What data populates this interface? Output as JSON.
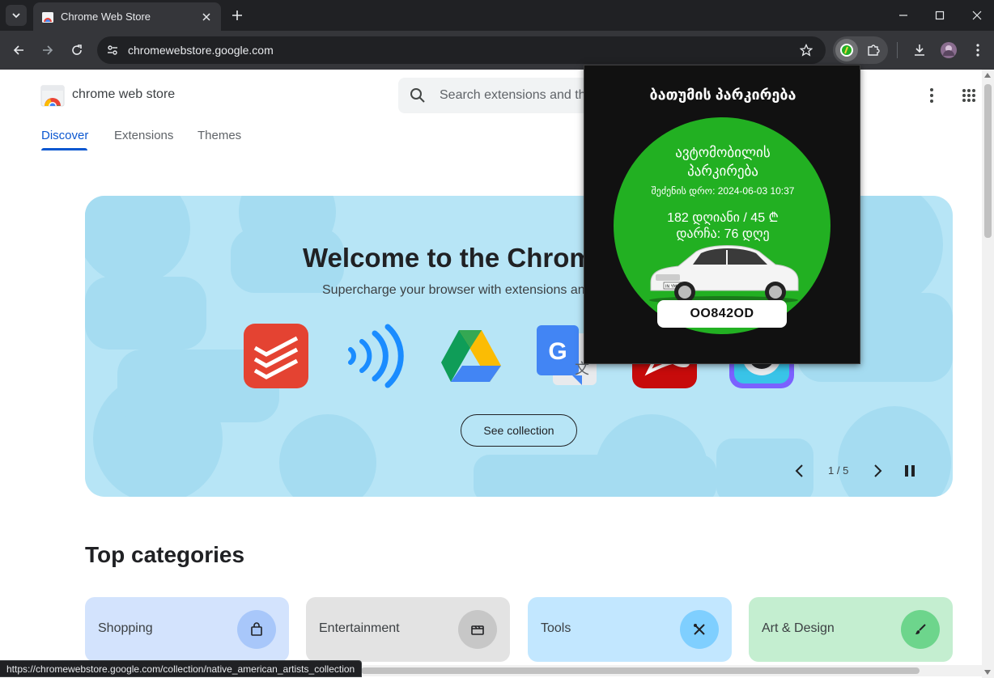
{
  "browser": {
    "tab_title": "Chrome Web Store",
    "url": "chromewebstore.google.com"
  },
  "store": {
    "brand": "chrome web store",
    "search_placeholder": "Search extensions and themes",
    "nav_tabs": [
      {
        "label": "Discover",
        "active": true
      },
      {
        "label": "Extensions",
        "active": false
      },
      {
        "label": "Themes",
        "active": false
      }
    ],
    "hero": {
      "title": "Welcome to the Chrome Web Store",
      "subtitle": "Supercharge your browser with extensions and themes for Chrome",
      "button": "See collection",
      "page_indicator": "1 / 5",
      "icons": [
        "todoist-icon",
        "nfc-waves-icon",
        "google-drive-icon",
        "google-translate-icon",
        "adobe-acrobat-icon",
        "camera-app-icon"
      ]
    },
    "top_categories_heading": "Top categories",
    "categories": [
      {
        "label": "Shopping",
        "icon": "shopping-bag-icon",
        "bg": "#d3e3fd",
        "icon_bg": "#a8c7fa"
      },
      {
        "label": "Entertainment",
        "icon": "clapperboard-icon",
        "bg": "#e3e3e3",
        "icon_bg": "#c7c7c7"
      },
      {
        "label": "Tools",
        "icon": "tools-icon",
        "bg": "#c2e7ff",
        "icon_bg": "#7fcfff"
      },
      {
        "label": "Art & Design",
        "icon": "brush-icon",
        "bg": "#c4eed0",
        "icon_bg": "#6dd58c"
      }
    ]
  },
  "status_url": "https://chromewebstore.google.com/collection/native_american_artists_collection",
  "popup": {
    "title": "ბათუმის პარკირება",
    "circle_title_line1": "ავტომობილის",
    "circle_title_line2": "პარკირება",
    "purchase_time": "შეძენის დრო: 2024-06-03 10:37",
    "plan": "182 დღიანი / 45 ₾",
    "remaining": "დარჩა: 76 დღე",
    "plate": "OO842OD",
    "car_plate_mini": "IN YM 34",
    "accent": "#22b022"
  }
}
